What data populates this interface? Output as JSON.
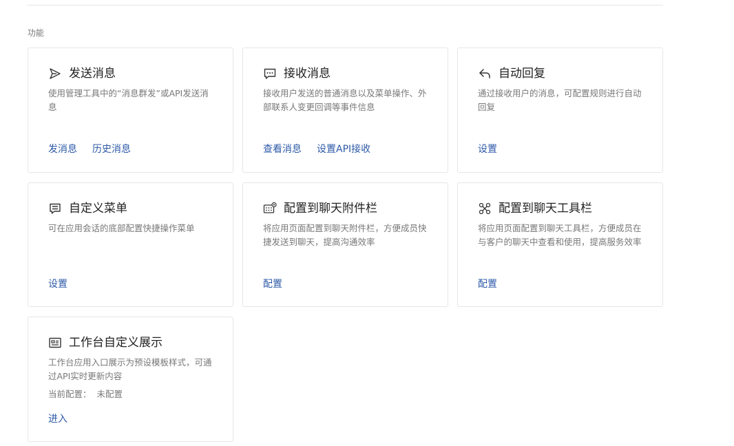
{
  "section": {
    "title": "功能"
  },
  "cards": [
    {
      "title": "发送消息",
      "icon": "send-icon",
      "description": "使用管理工具中的“消息群发”或API发送消息",
      "links": [
        "发消息",
        "历史消息"
      ]
    },
    {
      "title": "接收消息",
      "icon": "chat-bubble-icon",
      "description": "接收用户发送的普通消息以及菜单操作、外部联系人变更回调等事件信息",
      "links": [
        "查看消息",
        "设置API接收"
      ]
    },
    {
      "title": "自动回复",
      "icon": "reply-icon",
      "description": "通过接收用户的消息，可配置规则进行自动回复",
      "links": [
        "设置"
      ]
    },
    {
      "title": "自定义菜单",
      "icon": "menu-icon",
      "description": "可在应用会话的底部配置快捷操作菜单",
      "links": [
        "设置"
      ]
    },
    {
      "title": "配置到聊天附件栏",
      "icon": "attachment-bar-icon",
      "description": "将应用页面配置到聊天附件栏，方便成员快捷发送到聊天，提高沟通效率",
      "links": [
        "配置"
      ]
    },
    {
      "title": "配置到聊天工具栏",
      "icon": "toolbar-icon",
      "description": "将应用页面配置到聊天工具栏，方便成员在与客户的聊天中查看和使用，提高服务效率",
      "links": [
        "配置"
      ]
    },
    {
      "title": "工作台自定义展示",
      "icon": "workbench-card-icon",
      "description": "工作台应用入口展示为预设模板样式，可通过API实时更新内容",
      "config_label": "当前配置：",
      "config_value": "未配置",
      "links": [
        "进入"
      ]
    }
  ],
  "colors": {
    "link": "#2e5aa8",
    "border": "#e4e6e9",
    "muted": "#787878"
  }
}
